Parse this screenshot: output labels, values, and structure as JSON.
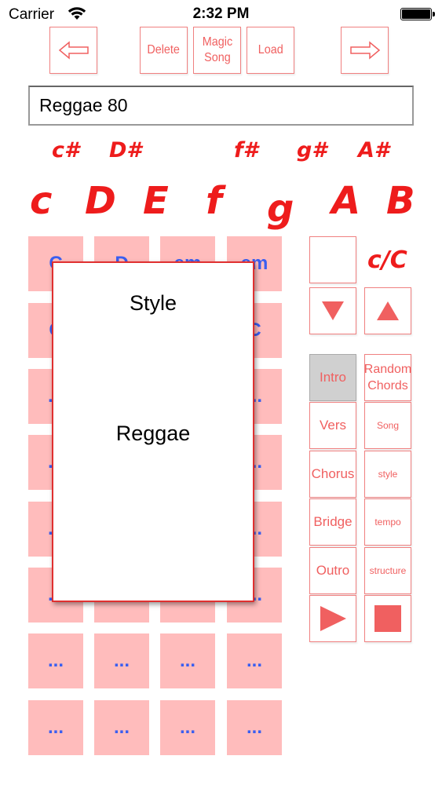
{
  "status_bar": {
    "carrier": "Carrier",
    "time": "2:32 PM",
    "battery_level": 1.0,
    "icons": [
      "wifi-icon",
      "battery-icon"
    ]
  },
  "toolbar": {
    "prev_icon": "arrow-left-icon",
    "delete_label": "Delete",
    "magic_song_label": "Magic Song",
    "load_label": "Load",
    "next_icon": "arrow-right-icon"
  },
  "song_name": "Reggae 80",
  "keys": {
    "sharps": [
      "c#",
      "D#",
      "f#",
      "g#",
      "A#"
    ],
    "naturals": [
      "c",
      "D",
      "E",
      "f",
      "g",
      "A",
      "B"
    ]
  },
  "chord_grid": {
    "visible_cells": [
      [
        "C",
        "D",
        "em",
        "em"
      ],
      [
        "C",
        "",
        "",
        "C"
      ],
      [
        "...",
        "",
        "",
        "..."
      ],
      [
        "...",
        "",
        "",
        "..."
      ],
      [
        "...",
        "",
        "",
        "..."
      ],
      [
        "...",
        "...",
        "...",
        "..."
      ],
      [
        "...",
        "...",
        "...",
        "..."
      ],
      [
        "...",
        "...",
        "...",
        "..."
      ]
    ]
  },
  "popup": {
    "title": "Style",
    "value": "Reggae"
  },
  "side_panel": {
    "case_toggle": "c/C",
    "down_icon": "triangle-down-icon",
    "up_icon": "triangle-up-icon",
    "intro": "Intro",
    "random_chords": "Random Chords",
    "vers": "Vers",
    "song": "Song",
    "chorus": "Chorus",
    "style": "style",
    "bridge": "Bridge",
    "tempo": "tempo",
    "outro": "Outro",
    "structure": "structure",
    "play_icon": "play-icon",
    "stop_icon": "stop-icon"
  },
  "colors": {
    "accent": "#f06060",
    "note_red": "#ee1c1c",
    "cell_pink": "#ffbcbc",
    "chord_blue": "#3a5ef0",
    "active_gray": "#d0d0d0"
  }
}
